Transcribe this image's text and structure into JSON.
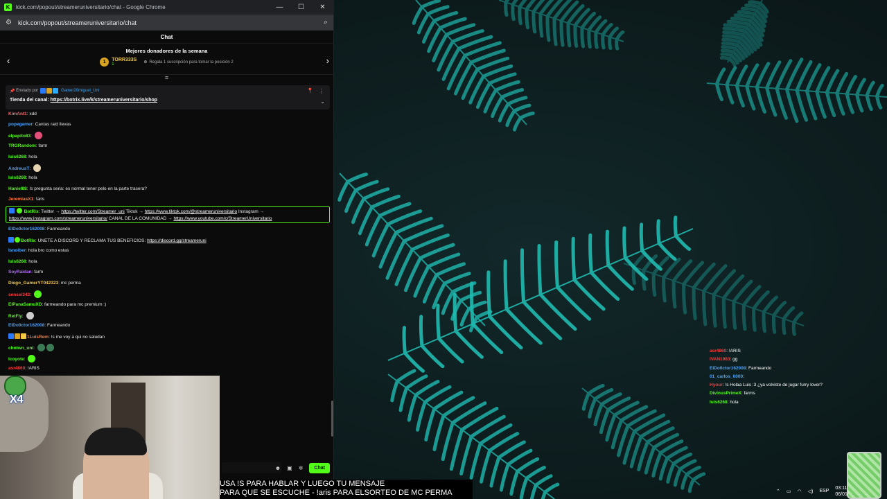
{
  "window": {
    "title": "kick.com/popout/streameruniversitario/chat - Google Chrome",
    "url": "kick.com/popout/streameruniversitario/chat",
    "controls": [
      "—",
      "☐",
      "✕"
    ]
  },
  "chat": {
    "header": "Chat",
    "donors": {
      "title": "Mejores donadores de la semana",
      "rank": "1",
      "name": "TORR333S",
      "sub": "1",
      "hint": "Regala 1 suscripción para tomar la posición 2"
    },
    "pinned": {
      "sent_by_label": "Enviado por",
      "sender": "Gamer20miguel_Uni",
      "text_prefix": "Tienda del canal:",
      "link": "https://botrix.live/k/streameruniversitario/shop"
    },
    "messages": [
      {
        "user": "KimAnt1",
        "color": "#ff6a6a",
        "text": "xdd"
      },
      {
        "user": "popegamer",
        "color": "#4aa3ff",
        "text": "Cantas raid llevas"
      },
      {
        "user": "elpapito83",
        "color": "#53fc18",
        "text": "",
        "emote": "#e0507a"
      },
      {
        "user": "TRGRandom",
        "color": "#53fc18",
        "text": "farm"
      },
      {
        "user": "luis6268",
        "color": "#53fc18",
        "text": "hola"
      },
      {
        "user": "AndreusT",
        "color": "#4aa3ff",
        "text": "",
        "emote": "#e6d3b0"
      },
      {
        "user": "luis6268",
        "color": "#53fc18",
        "text": "hola"
      },
      {
        "user": "Haniel88",
        "color": "#53fc18",
        "text": "!s pregunta seria: es normal tener pelo en la parte trasera?"
      },
      {
        "user": "JeremiasX1",
        "color": "#ff7a3a",
        "text": "!aris"
      }
    ],
    "botrix_box": {
      "user": "BotRix",
      "text1": "Twitter →",
      "link1": "https://twitter.com/Streamer_uni",
      "text2": "Tiktok →",
      "link2": "https://www.tiktok.com/@streameruniversitario",
      "text3": "Instagram →",
      "link3": "https://www.instagram.com/streameruniversitario/",
      "text4": "CANAL DE LA COMUNIDAD →",
      "link4": "https://www.youtube.com/c/StreamerUniversitario"
    },
    "messages2": [
      {
        "user": "ElDo0ctor162008",
        "color": "#4aa3ff",
        "text": "Farmeando"
      },
      {
        "user": "BotRix",
        "color": "#53fc18",
        "text": "UNETE A DISCORD Y RECLAMA TUS BENEFICIOS:",
        "link": "https://discord.gg/streameruni"
      },
      {
        "user": "Isnoiber",
        "color": "#4aa3ff",
        "text": "hola bro como estas"
      },
      {
        "user": "luis6268",
        "color": "#53fc18",
        "text": "hola"
      },
      {
        "user": "SoyRaidan",
        "color": "#b36bff",
        "text": "farm"
      },
      {
        "user": "Diego_GamerYT042323",
        "color": "#f5c842",
        "text": "mc perma"
      },
      {
        "user": "sensei343",
        "color": "#ff3a3a",
        "text": "",
        "emote": "#53fc18"
      },
      {
        "user": "ElPanaSamuXD",
        "color": "#53fc18",
        "text": "farmeando para mc premium :)"
      },
      {
        "user": "RetFly",
        "color": "#53fc18",
        "text": "",
        "emote": "#cccccc"
      },
      {
        "user": "ElDo0ctor162008",
        "color": "#4aa3ff",
        "text": "Farmeando"
      },
      {
        "user": "1LuisRem",
        "color": "#ff7a3a",
        "text": "!s me voy a qui no saludan"
      },
      {
        "user": "chntwn_uni",
        "color": "#53fc18",
        "text": "",
        "emote": "#3a7a55"
      },
      {
        "user": "Icoyote",
        "color": "#53fc18",
        "text": "",
        "emote": "#53fc18"
      },
      {
        "user": "asr4860",
        "color": "#ff3a3a",
        "text": "!ARIS"
      }
    ],
    "input_send": "Chat"
  },
  "webcam": {
    "badge": "X4"
  },
  "caption": {
    "line1": "USA !S PARA HABLAR Y LUEGO TU MENSAJE",
    "line2": "PARA QUE SE ESCUCHE - !aris PARA ELSORTEO DE MC PERMA"
  },
  "overlay_chat": [
    {
      "user": "asr4860",
      "color": "#ff3a3a",
      "text": ": !ARIS"
    },
    {
      "user": "IVAN1983",
      "color": "#ff3a3a",
      "text": ": gg"
    },
    {
      "user": "ElDo0ctor162008",
      "color": "#4aa3ff",
      "text": ": Farmeando"
    },
    {
      "user": "01_carlos_0000",
      "color": "#4aa3ff",
      "text": ":"
    },
    {
      "user": "Hyour",
      "color": "#ff3a3a",
      "text": ": !s Holaa Luis :3 ¿ya volviste de jugar furry lover?"
    },
    {
      "user": "DivinusPrimeX",
      "color": "#53fc18",
      "text": ": farms"
    },
    {
      "user": "luis6268",
      "color": "#53fc18",
      "text": ": hola"
    }
  ],
  "taskbar": {
    "lang": "ESP",
    "time": "03:11",
    "date": "06/01/"
  },
  "colors": {
    "kick_green": "#53fc18",
    "bg_teal": "#1fbab0"
  }
}
